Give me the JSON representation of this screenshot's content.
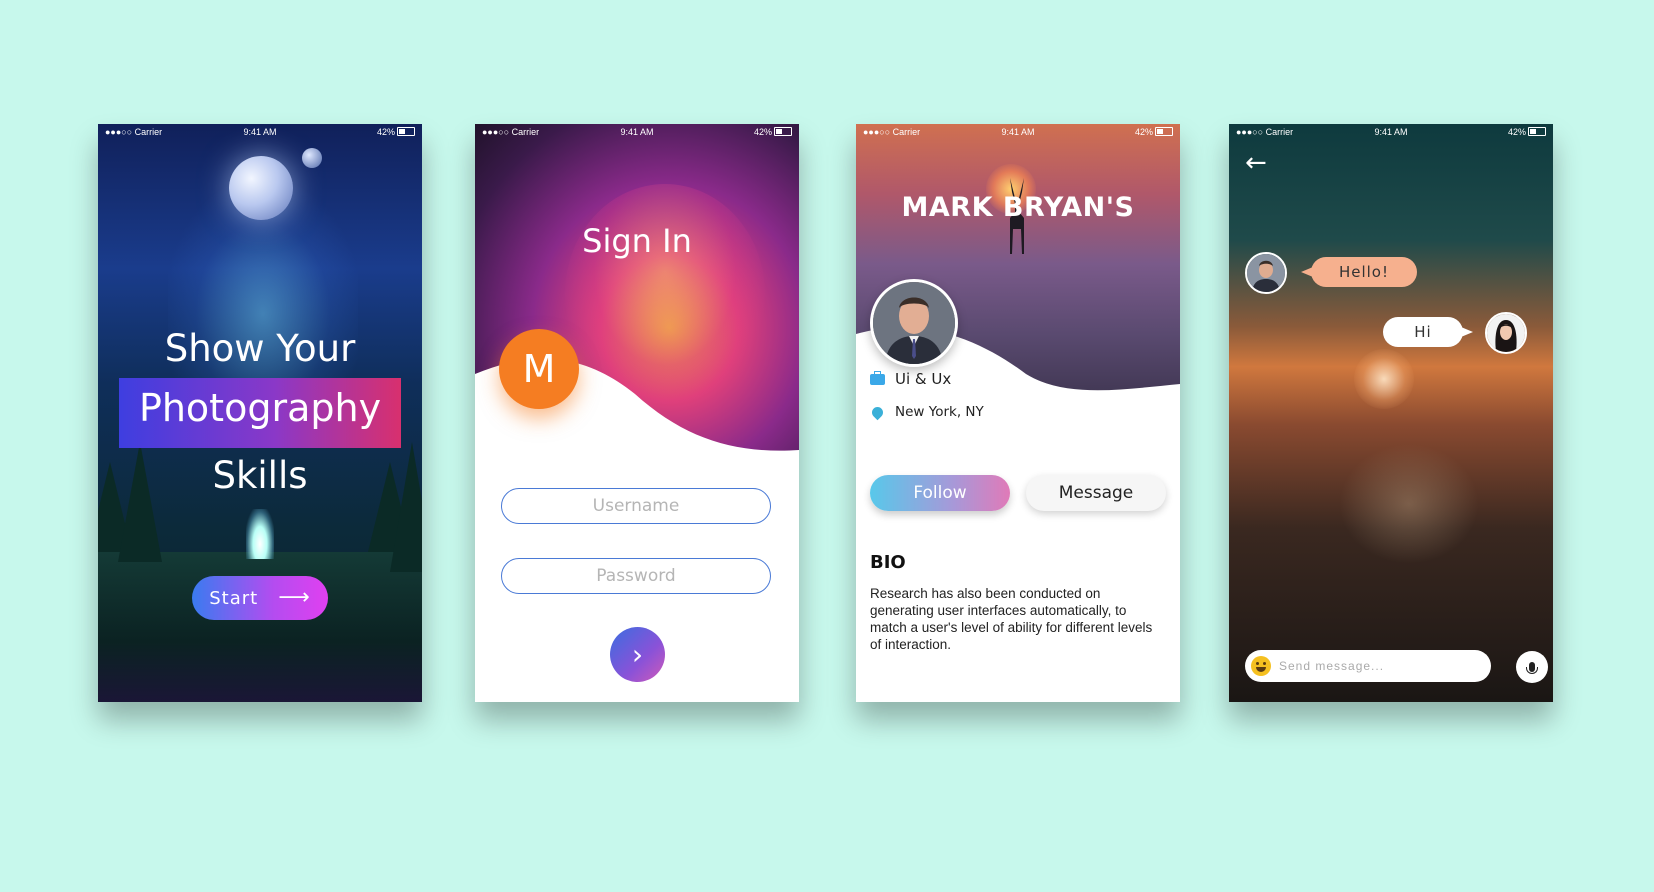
{
  "status_bar": {
    "carrier": "●●●○○ Carrier",
    "time": "9:41 AM",
    "battery": "42%"
  },
  "screen1": {
    "line1": "Show Your",
    "line2": "Photography",
    "line3": "Skills",
    "start_label": "Start",
    "arrow_icon": "arrow-right-icon"
  },
  "screen2": {
    "title": "Sign In",
    "avatar_letter": "M",
    "username_placeholder": "Username",
    "password_placeholder": "Password",
    "next_icon": "chevron-right-icon"
  },
  "screen3": {
    "name": "MARK BRYAN'S",
    "job": "Ui & Ux",
    "location": "New York, NY",
    "follow_label": "Follow",
    "message_label": "Message",
    "bio_heading": "BIO",
    "bio_text": "Research has also been conducted on generating user interfaces automatically, to match a user's level of ability for different levels of interaction."
  },
  "screen4": {
    "incoming_message": "Hello!",
    "outgoing_message": "Hi",
    "input_placeholder": "Send message..."
  },
  "colors": {
    "background": "#c7f8ec",
    "avatar_orange": "#f57d22",
    "bubble_peach": "#f6b08e"
  }
}
